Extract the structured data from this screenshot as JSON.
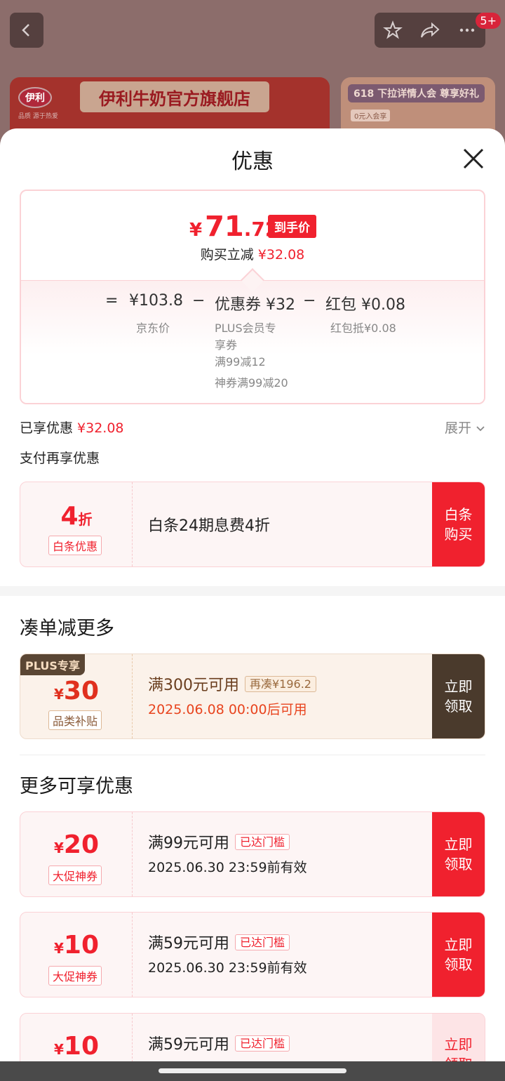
{
  "background": {
    "store_banner_logo": "伊利",
    "store_banner_logo_sub": "品质 源于热爱",
    "store_banner_title": "伊利牛奶官方旗舰店",
    "promo_title": "618 下拉详情人会 尊享好礼",
    "promo_sub": "0元入会享",
    "notification_count": "5+"
  },
  "sheet": {
    "title": "优惠",
    "final_price": {
      "symbol": "¥",
      "integer": "71",
      "decimal": ".72",
      "tag": "到手价"
    },
    "saving": {
      "label": "购买立减",
      "value": "¥32.08"
    },
    "equation": {
      "eq": "=",
      "base_price": "¥103.8",
      "minus1": "−",
      "coupon": "优惠券 ¥32",
      "minus2": "−",
      "redpack": "红包 ¥0.08",
      "base_label": "京东价",
      "coupon_lines": [
        "PLUS会员专",
        "享券",
        "满99减12"
      ],
      "coupon_line2": "神券满99减20",
      "redpack_label": "红包抵¥0.08"
    },
    "enjoyed": {
      "label": "已享优惠",
      "value": "¥32.08"
    },
    "expand_label": "展开",
    "pay_more_label": "支付再享优惠",
    "baitiao": {
      "discount_num": "4",
      "discount_unit": "折",
      "tag": "白条优惠",
      "description": "白条24期息费4折",
      "action": [
        "白条",
        "购买"
      ]
    },
    "section_more_order": "凑单减更多",
    "plus_coupon": {
      "badge": "PLUS专享",
      "currency": "¥",
      "amount": "30",
      "tag": "品类补贴",
      "condition": "满300元可用",
      "chip": "再凑¥196.2",
      "valid": "2025.06.08 00:00后可用",
      "action": [
        "立即",
        "领取"
      ]
    },
    "section_more_offers": "更多可享优惠",
    "coupons": [
      {
        "currency": "¥",
        "amount": "20",
        "tag": "大促神券",
        "condition": "满99元可用",
        "chip": "已达门槛",
        "valid": "2025.06.30 23:59前有效",
        "action": [
          "立即",
          "领取"
        ]
      },
      {
        "currency": "¥",
        "amount": "10",
        "tag": "大促神券",
        "condition": "满59元可用",
        "chip": "已达门槛",
        "valid": "2025.06.30 23:59前有效",
        "action": [
          "立即",
          "领取"
        ]
      },
      {
        "currency": "¥",
        "amount": "10",
        "tag": "",
        "condition": "满59元可用",
        "chip": "已达门槛",
        "valid": "",
        "action": [
          "立即",
          "领取"
        ]
      }
    ]
  }
}
